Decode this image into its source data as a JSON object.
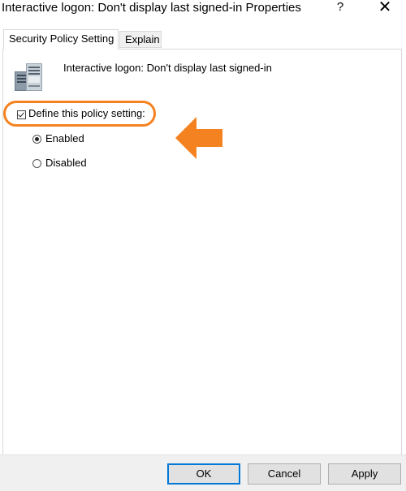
{
  "window": {
    "title": "Interactive logon: Don't display last signed-in Properties",
    "help_label": "?",
    "close_label": "✕"
  },
  "tabs": [
    {
      "label": "Security Policy Setting",
      "active": true
    },
    {
      "label": "Explain",
      "active": false
    }
  ],
  "policy": {
    "icon": "server-icon",
    "name": "Interactive logon: Don't display last signed-in"
  },
  "define_setting": {
    "label": "Define this policy setting:",
    "checked": true
  },
  "options": [
    {
      "label": "Enabled",
      "selected": true
    },
    {
      "label": "Disabled",
      "selected": false
    }
  ],
  "annotation": {
    "highlight_color": "#f58220",
    "arrow_color": "#f58220",
    "arrow_icon": "arrow-left-icon"
  },
  "buttons": {
    "ok_label": "OK",
    "cancel_label": "Cancel",
    "apply_label": "Apply"
  }
}
